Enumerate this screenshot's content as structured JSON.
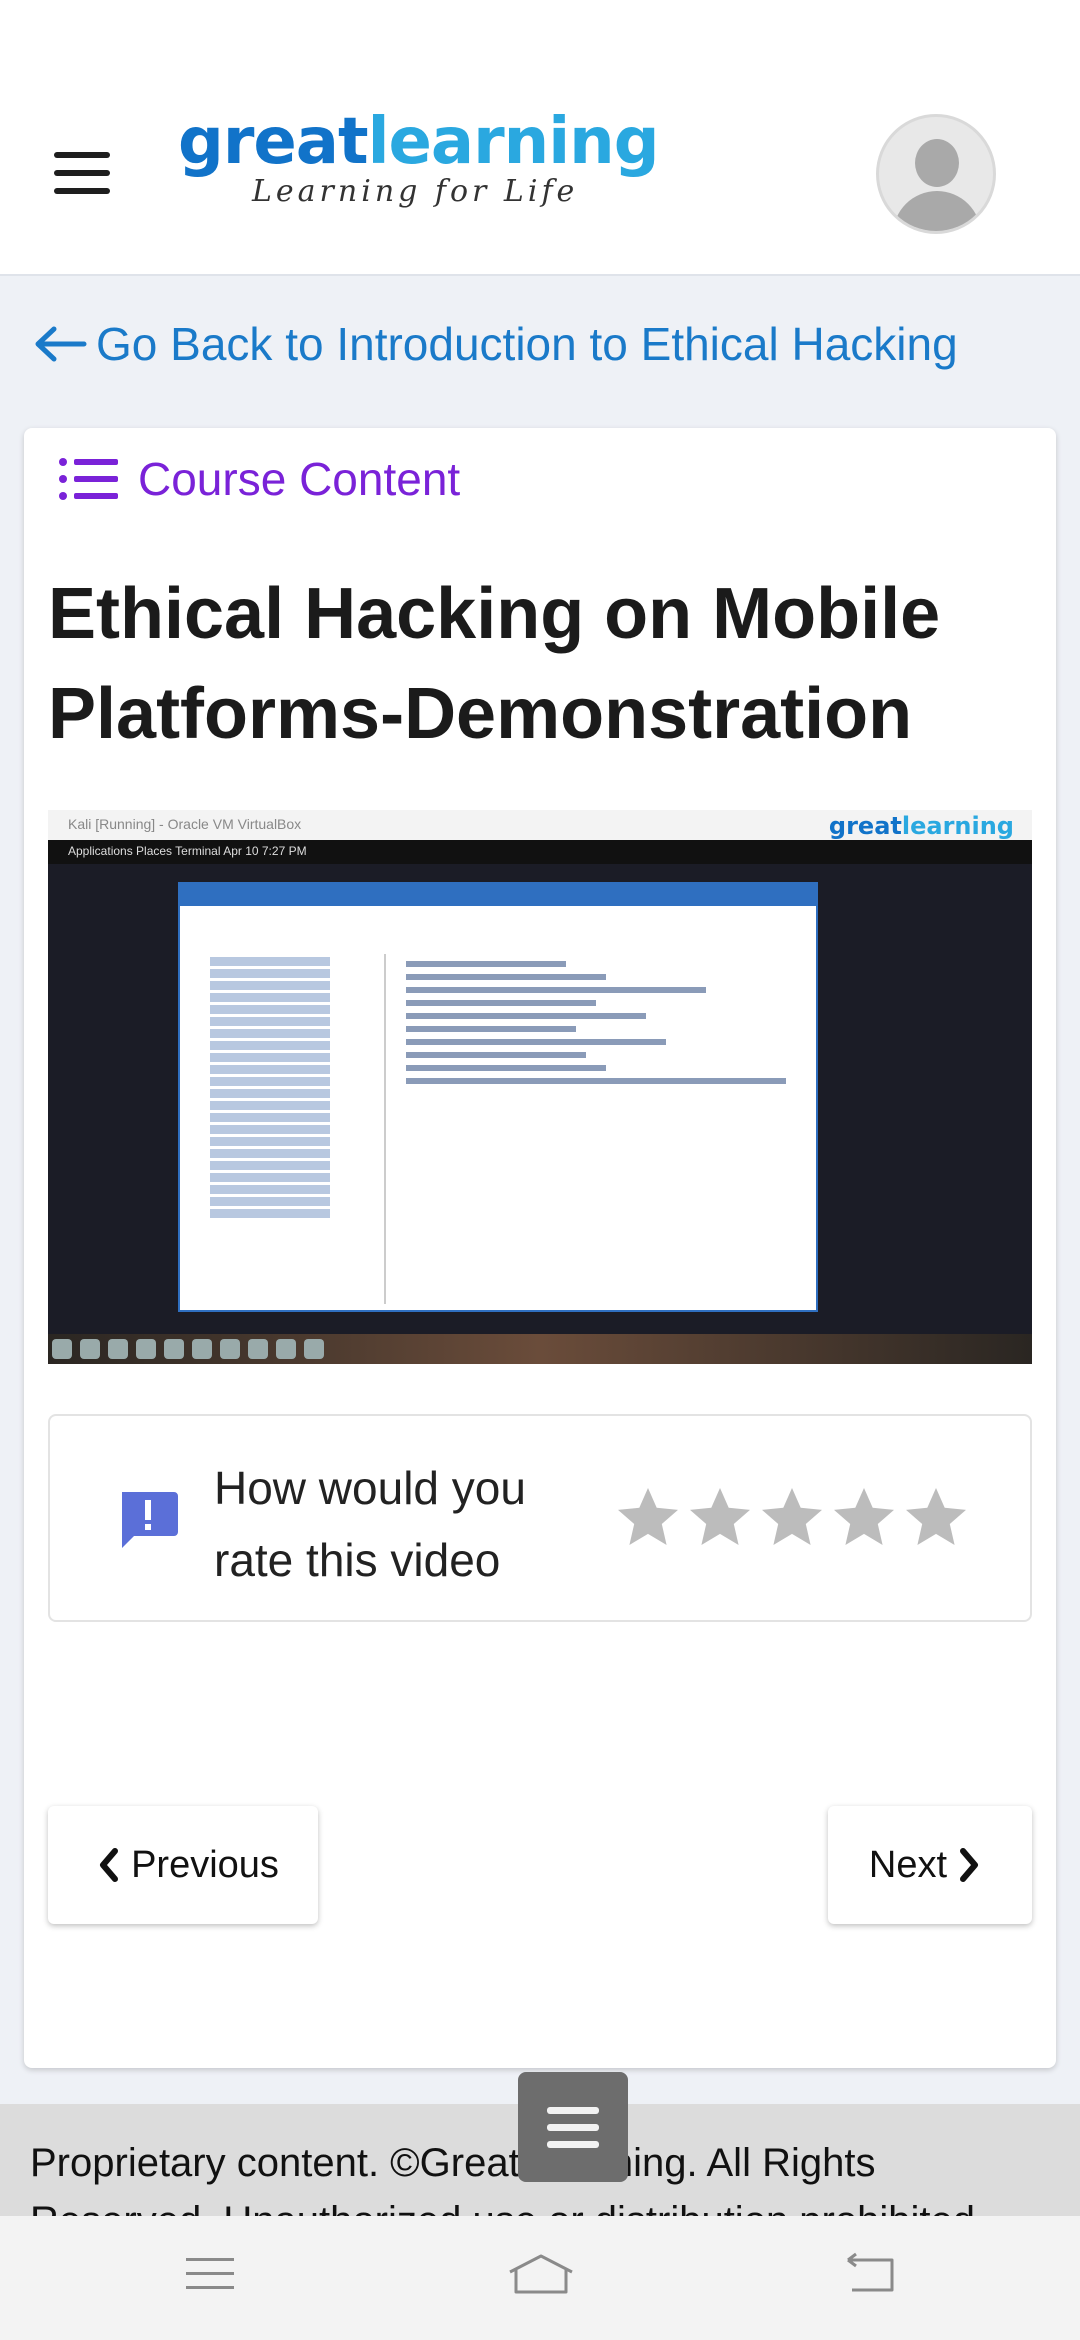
{
  "header": {
    "logo_part1": "great",
    "logo_part2": "learning",
    "logo_tagline": "Learning for Life"
  },
  "back_link": {
    "label": "Go Back to Introduction to Ethical Hacking"
  },
  "course_content": {
    "label": "Course Content"
  },
  "lesson": {
    "title": "Ethical Hacking on Mobile Platforms-Demonstration"
  },
  "video": {
    "vm_title": "Kali [Running] - Oracle VM VirtualBox",
    "watermark_part1": "great",
    "watermark_part2": "learning",
    "topbar": "Applications    Places    Terminal                              Apr 10  7:27 PM"
  },
  "rating": {
    "question": "How would you rate this video",
    "stars_total": 5,
    "stars_selected": 0
  },
  "navigation": {
    "previous_label": "Previous",
    "next_label": "Next"
  },
  "footer": {
    "text": "Proprietary content. ©Great Learning. All Rights Reserved. Unauthorized use or distribution prohibited."
  },
  "colors": {
    "link_blue": "#1a7ac9",
    "course_purple": "#7a22d8",
    "feedback_icon": "#5b6fd8",
    "star_gray": "#bcbcbc"
  }
}
